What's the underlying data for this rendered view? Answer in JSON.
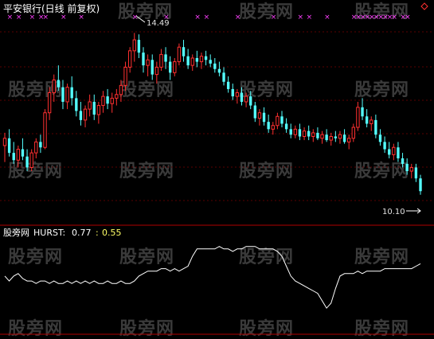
{
  "title": "平安银行(日线 前复权)",
  "watermark_text": "股旁网",
  "colors": {
    "up": "#ff3030",
    "down": "#54ffff",
    "flat": "#ffffff",
    "marker": "#ff40ff",
    "grid": "#5a0000",
    "hurst": "#ffffff",
    "label_yellow": "#ffff66",
    "divider": "#b00000"
  },
  "diamond_icon": "diamond-outline-icon",
  "chart_data": [
    {
      "type": "candlestick",
      "title": "平安银行(日线 前复权)",
      "ylim": [
        9.5,
        15.0
      ],
      "annotations": [
        {
          "text": "14.49",
          "value": 14.49,
          "kind": "max"
        },
        {
          "text": "10.10",
          "value": 10.1,
          "kind": "min"
        }
      ],
      "marker_symbol": "×",
      "grid": "dashed-horizontal",
      "candles": [
        [
          11.4,
          11.75,
          10.95,
          11.6
        ],
        [
          11.6,
          11.85,
          11.1,
          11.2
        ],
        [
          11.2,
          11.5,
          10.9,
          11.0
        ],
        [
          11.0,
          11.4,
          10.8,
          11.3
        ],
        [
          11.3,
          11.6,
          11.0,
          11.1
        ],
        [
          11.1,
          11.3,
          10.7,
          10.8
        ],
        [
          10.8,
          11.3,
          10.7,
          11.2
        ],
        [
          11.2,
          11.6,
          11.05,
          11.5
        ],
        [
          11.5,
          11.7,
          11.2,
          11.35
        ],
        [
          11.35,
          12.4,
          11.3,
          12.3
        ],
        [
          12.3,
          13.0,
          12.1,
          12.85
        ],
        [
          12.85,
          13.35,
          12.6,
          13.2
        ],
        [
          13.2,
          13.6,
          12.9,
          13.0
        ],
        [
          13.0,
          13.2,
          12.4,
          12.6
        ],
        [
          12.6,
          13.1,
          12.4,
          13.0
        ],
        [
          13.0,
          13.3,
          12.5,
          12.7
        ],
        [
          12.7,
          12.9,
          12.2,
          12.35
        ],
        [
          12.35,
          12.6,
          11.95,
          12.1
        ],
        [
          12.1,
          12.5,
          11.9,
          12.4
        ],
        [
          12.4,
          12.8,
          12.2,
          12.6
        ],
        [
          12.6,
          12.8,
          12.1,
          12.25
        ],
        [
          12.25,
          12.6,
          12.0,
          12.5
        ],
        [
          12.5,
          12.9,
          12.3,
          12.75
        ],
        [
          12.75,
          12.95,
          12.4,
          12.55
        ],
        [
          12.55,
          12.85,
          12.3,
          12.7
        ],
        [
          12.7,
          12.95,
          12.5,
          12.8
        ],
        [
          12.8,
          13.2,
          12.6,
          13.05
        ],
        [
          13.05,
          13.7,
          12.9,
          13.55
        ],
        [
          13.55,
          14.1,
          13.4,
          14.0
        ],
        [
          14.0,
          14.49,
          13.7,
          14.3
        ],
        [
          14.3,
          14.45,
          13.8,
          13.95
        ],
        [
          13.95,
          14.1,
          13.4,
          13.6
        ],
        [
          13.6,
          13.9,
          13.3,
          13.75
        ],
        [
          13.75,
          13.9,
          13.2,
          13.35
        ],
        [
          13.35,
          13.7,
          13.1,
          13.55
        ],
        [
          13.55,
          14.05,
          13.45,
          13.9
        ],
        [
          13.9,
          14.1,
          13.5,
          13.7
        ],
        [
          13.7,
          13.85,
          13.2,
          13.4
        ],
        [
          13.4,
          13.8,
          13.3,
          13.7
        ],
        [
          13.7,
          14.2,
          13.6,
          14.1
        ],
        [
          14.1,
          14.3,
          13.7,
          13.85
        ],
        [
          13.85,
          14.05,
          13.5,
          13.6
        ],
        [
          13.6,
          13.9,
          13.45,
          13.8
        ],
        [
          13.8,
          14.0,
          13.55,
          13.7
        ],
        [
          13.7,
          13.95,
          13.5,
          13.85
        ],
        [
          13.85,
          14.0,
          13.6,
          13.75
        ],
        [
          13.75,
          13.9,
          13.55,
          13.65
        ],
        [
          13.65,
          13.8,
          13.4,
          13.5
        ],
        [
          13.5,
          13.7,
          13.3,
          13.4
        ],
        [
          13.4,
          13.55,
          13.05,
          13.15
        ],
        [
          13.15,
          13.3,
          12.85,
          12.95
        ],
        [
          12.95,
          13.1,
          12.65,
          12.75
        ],
        [
          12.75,
          12.95,
          12.55,
          12.85
        ],
        [
          12.85,
          13.0,
          12.5,
          12.6
        ],
        [
          12.6,
          12.85,
          12.45,
          12.75
        ],
        [
          12.75,
          12.9,
          12.4,
          12.5
        ],
        [
          12.5,
          12.6,
          12.05,
          12.15
        ],
        [
          12.15,
          12.4,
          11.95,
          12.3
        ],
        [
          12.3,
          12.45,
          11.95,
          12.05
        ],
        [
          12.05,
          12.25,
          11.75,
          11.85
        ],
        [
          11.85,
          12.05,
          11.7,
          11.95
        ],
        [
          11.95,
          12.3,
          11.85,
          12.2
        ],
        [
          12.2,
          12.35,
          11.9,
          12.0
        ],
        [
          12.0,
          12.15,
          11.75,
          11.85
        ],
        [
          11.85,
          12.0,
          11.6,
          11.7
        ],
        [
          11.7,
          11.95,
          11.6,
          11.85
        ],
        [
          11.85,
          12.0,
          11.55,
          11.65
        ],
        [
          11.65,
          11.9,
          11.55,
          11.8
        ],
        [
          11.8,
          11.95,
          11.55,
          11.65
        ],
        [
          11.65,
          11.85,
          11.5,
          11.75
        ],
        [
          11.75,
          11.9,
          11.55,
          11.6
        ],
        [
          11.6,
          11.8,
          11.45,
          11.7
        ],
        [
          11.7,
          11.85,
          11.5,
          11.55
        ],
        [
          11.55,
          11.75,
          11.4,
          11.65
        ],
        [
          11.65,
          11.8,
          11.5,
          11.6
        ],
        [
          11.6,
          11.8,
          11.45,
          11.7
        ],
        [
          11.7,
          11.85,
          11.45,
          11.5
        ],
        [
          11.5,
          11.7,
          11.3,
          11.6
        ],
        [
          11.6,
          12.0,
          11.5,
          11.9
        ],
        [
          11.9,
          12.6,
          11.8,
          12.45
        ],
        [
          12.45,
          12.7,
          12.1,
          12.2
        ],
        [
          12.2,
          12.4,
          11.9,
          12.0
        ],
        [
          12.0,
          12.2,
          11.8,
          12.1
        ],
        [
          12.1,
          12.25,
          11.6,
          11.7
        ],
        [
          11.7,
          11.85,
          11.4,
          11.5
        ],
        [
          11.5,
          11.65,
          11.2,
          11.3
        ],
        [
          11.3,
          11.5,
          11.05,
          11.15
        ],
        [
          11.15,
          11.45,
          11.0,
          11.35
        ],
        [
          11.35,
          11.5,
          10.95,
          11.05
        ],
        [
          11.05,
          11.2,
          10.8,
          10.9
        ],
        [
          10.9,
          11.05,
          10.6,
          10.7
        ],
        [
          10.7,
          10.9,
          10.5,
          10.8
        ],
        [
          10.8,
          10.9,
          10.4,
          10.5
        ],
        [
          10.5,
          10.6,
          10.05,
          10.15
        ]
      ],
      "markers_at": [
        1,
        3,
        6,
        8,
        9,
        13,
        17,
        29,
        36,
        43,
        45,
        52,
        60,
        66,
        68,
        72,
        78,
        79,
        80,
        81,
        82,
        83,
        84,
        85,
        86,
        87,
        89,
        90
      ]
    },
    {
      "type": "line",
      "title": "HURST",
      "series": [
        {
          "name": "HURST",
          "values": [
            0.66,
            0.64,
            0.66,
            0.67,
            0.65,
            0.64,
            0.64,
            0.63,
            0.64,
            0.64,
            0.63,
            0.64,
            0.63,
            0.63,
            0.64,
            0.63,
            0.64,
            0.63,
            0.64,
            0.63,
            0.64,
            0.63,
            0.63,
            0.64,
            0.63,
            0.63,
            0.64,
            0.63,
            0.63,
            0.64,
            0.66,
            0.67,
            0.68,
            0.68,
            0.68,
            0.69,
            0.69,
            0.68,
            0.69,
            0.68,
            0.69,
            0.7,
            0.74,
            0.77,
            0.77,
            0.77,
            0.77,
            0.77,
            0.78,
            0.77,
            0.77,
            0.76,
            0.77,
            0.77,
            0.78,
            0.78,
            0.78,
            0.77,
            0.77,
            0.77,
            0.77,
            0.76,
            0.74,
            0.7,
            0.66,
            0.64,
            0.63,
            0.62,
            0.61,
            0.6,
            0.59,
            0.56,
            0.53,
            0.55,
            0.61,
            0.66,
            0.67,
            0.67,
            0.67,
            0.68,
            0.67,
            0.68,
            0.68,
            0.68,
            0.68,
            0.69,
            0.69,
            0.69,
            0.69,
            0.69,
            0.69,
            0.69,
            0.7,
            0.71
          ]
        }
      ],
      "labels": {
        "name": "HURST:",
        "value": "0.77",
        "ref": "0.55",
        "watermark": "股旁网"
      },
      "ylim": [
        0.45,
        0.85
      ]
    }
  ]
}
